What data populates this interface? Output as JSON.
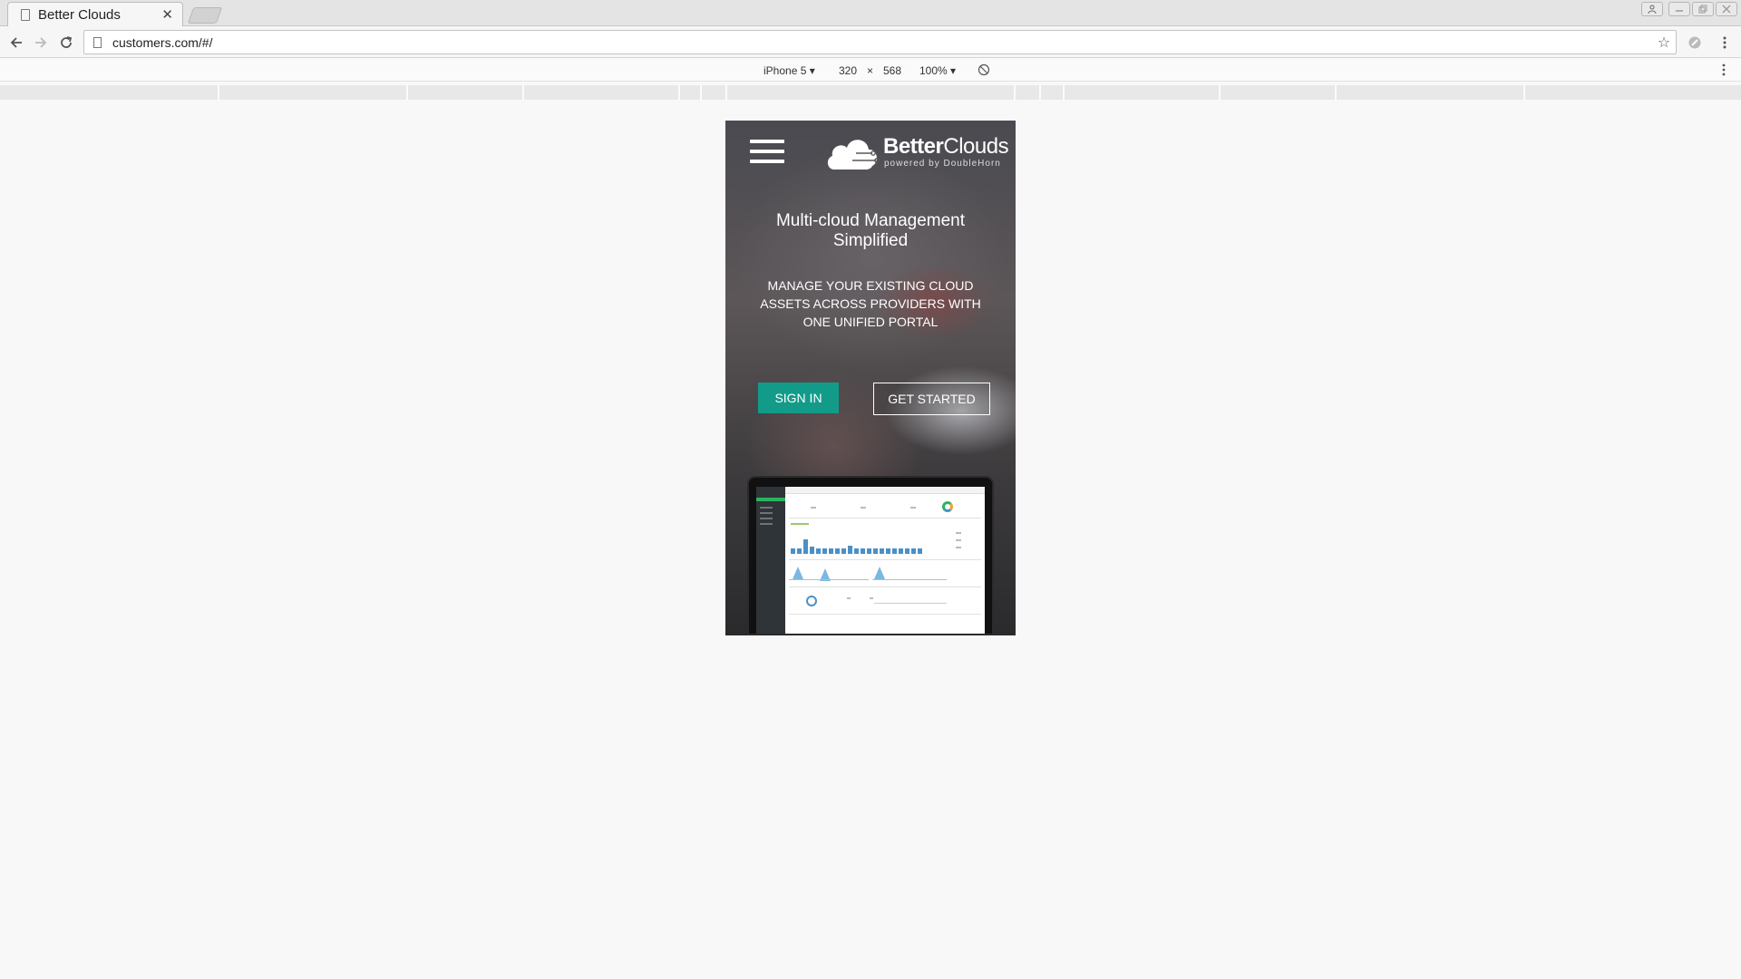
{
  "browser": {
    "tab_title": "Better Clouds",
    "tab_close": "✕",
    "url": "customers.com/#/",
    "bookmark_star": "☆"
  },
  "device_toolbar": {
    "device": "iPhone 5 ▾",
    "width": "320",
    "times": "×",
    "height": "568",
    "zoom": "100% ▾"
  },
  "page": {
    "logo": {
      "brand_bold": "Better",
      "brand_thin": "Clouds",
      "tagline": "powered by DoubleHorn"
    },
    "headline": "Multi-cloud Management Simplified",
    "subhead": "MANAGE YOUR EXISTING CLOUD ASSETS ACROSS PROVIDERS WITH ONE UNIFIED PORTAL",
    "buttons": {
      "sign_in": "SIGN IN",
      "get_started": "GET STARTED"
    }
  },
  "colors": {
    "accent": "#139b8a",
    "page_background": "#f8f8f8"
  }
}
